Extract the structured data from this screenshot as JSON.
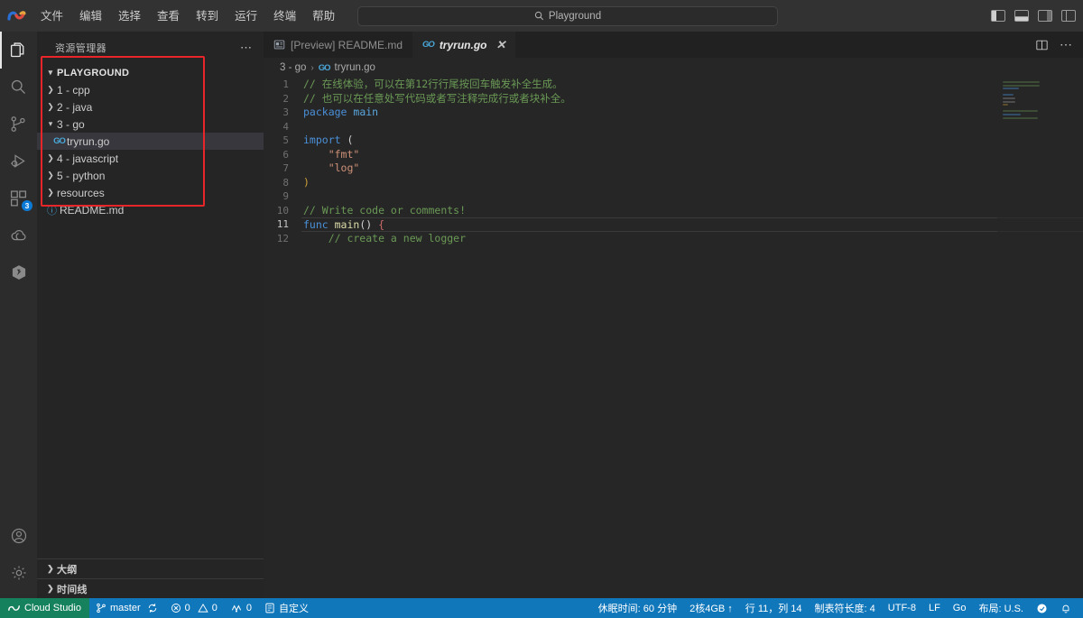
{
  "titlebar": {
    "logo_name": "cloud-studio-logo",
    "menu": [
      {
        "label": "文件",
        "name": "menu-file"
      },
      {
        "label": "编辑",
        "name": "menu-edit"
      },
      {
        "label": "选择",
        "name": "menu-selection"
      },
      {
        "label": "查看",
        "name": "menu-view"
      },
      {
        "label": "转到",
        "name": "menu-go"
      },
      {
        "label": "运行",
        "name": "menu-run"
      },
      {
        "label": "终端",
        "name": "menu-terminal"
      },
      {
        "label": "帮助",
        "name": "menu-help"
      }
    ],
    "nav": {
      "back": "←",
      "forward": "→"
    },
    "search": {
      "value": "Playground",
      "icon": "search-icon"
    },
    "window_controls": [
      {
        "name": "toggle-primary-sidebar-button"
      },
      {
        "name": "toggle-panel-button"
      },
      {
        "name": "toggle-secondary-sidebar-button"
      },
      {
        "name": "customize-layout-button"
      }
    ]
  },
  "activitybar": {
    "items": [
      {
        "name": "activity-explorer",
        "icon": "files-icon",
        "active": true
      },
      {
        "name": "activity-search",
        "icon": "search-icon",
        "active": false
      },
      {
        "name": "activity-source-control",
        "icon": "source-control-icon",
        "active": false
      },
      {
        "name": "activity-run-debug",
        "icon": "run-debug-icon",
        "active": false
      },
      {
        "name": "activity-extensions",
        "icon": "extensions-icon",
        "active": false,
        "badge": "3"
      },
      {
        "name": "activity-cloud",
        "icon": "cloud-icon",
        "active": false
      },
      {
        "name": "activity-plugin",
        "icon": "hexagon-icon",
        "active": false
      }
    ],
    "bottom": [
      {
        "name": "activity-account",
        "icon": "account-icon"
      },
      {
        "name": "activity-settings",
        "icon": "gear-icon"
      }
    ]
  },
  "sidebar": {
    "title": "资源管理器",
    "more_actions": "⋯",
    "tree": [
      {
        "label": "PLAYGROUND",
        "name": "tree-root-playground",
        "kind": "root",
        "expanded": true,
        "indent": 0
      },
      {
        "label": "1 - cpp",
        "name": "tree-folder-cpp",
        "kind": "folder",
        "expanded": false,
        "indent": 1
      },
      {
        "label": "2 - java",
        "name": "tree-folder-java",
        "kind": "folder",
        "expanded": false,
        "indent": 1
      },
      {
        "label": "3 - go",
        "name": "tree-folder-go",
        "kind": "folder",
        "expanded": true,
        "indent": 1
      },
      {
        "label": "tryrun.go",
        "name": "tree-file-tryrun-go",
        "kind": "file-go",
        "selected": true,
        "indent": 2
      },
      {
        "label": "4 - javascript",
        "name": "tree-folder-javascript",
        "kind": "folder",
        "expanded": false,
        "indent": 1
      },
      {
        "label": "5 - python",
        "name": "tree-folder-python",
        "kind": "folder",
        "expanded": false,
        "indent": 1
      },
      {
        "label": "resources",
        "name": "tree-folder-resources",
        "kind": "folder",
        "expanded": false,
        "indent": 1
      },
      {
        "label": "README.md",
        "name": "tree-file-readme-md",
        "kind": "file-md",
        "indent": 1
      }
    ],
    "sections": [
      {
        "label": "大纲",
        "name": "sidebar-section-outline"
      },
      {
        "label": "时间线",
        "name": "sidebar-section-timeline"
      }
    ],
    "annotation_color": "#e8262a"
  },
  "editor": {
    "tabs": [
      {
        "label": "[Preview] README.md",
        "name": "tab-readme-preview",
        "icon": "preview-icon",
        "active": false
      },
      {
        "label": "tryrun.go",
        "name": "tab-tryrun-go",
        "icon": "go-icon",
        "active": true,
        "close": "✕"
      }
    ],
    "tab_actions": [
      {
        "name": "split-editor-button"
      },
      {
        "name": "editor-more-actions-button",
        "label": "⋯"
      }
    ],
    "breadcrumb": {
      "folder": "3 - go",
      "separator": "›",
      "file": "tryrun.go"
    },
    "lines": [
      {
        "n": "1",
        "tokens": [
          {
            "t": "// 在线体验，可以在第12行行尾按回车触发补全生成。",
            "c": "cmt"
          }
        ]
      },
      {
        "n": "2",
        "tokens": [
          {
            "t": "// 也可以在任意处写代码或者写注释完成行或者块补全。",
            "c": "cmt"
          }
        ]
      },
      {
        "n": "3",
        "tokens": [
          {
            "t": "package ",
            "c": "kw"
          },
          {
            "t": "main",
            "c": "kw2"
          }
        ]
      },
      {
        "n": "4",
        "tokens": []
      },
      {
        "n": "5",
        "tokens": [
          {
            "t": "import ",
            "c": "kw"
          },
          {
            "t": "(",
            "c": "punc"
          }
        ]
      },
      {
        "n": "6",
        "tokens": [
          {
            "t": "    ",
            "c": "punc"
          },
          {
            "t": "\"fmt\"",
            "c": "str"
          }
        ]
      },
      {
        "n": "7",
        "tokens": [
          {
            "t": "    ",
            "c": "punc"
          },
          {
            "t": "\"log\"",
            "c": "str"
          }
        ]
      },
      {
        "n": "8",
        "tokens": [
          {
            "t": ")",
            "c": "brk"
          }
        ]
      },
      {
        "n": "9",
        "tokens": []
      },
      {
        "n": "10",
        "tokens": [
          {
            "t": "// Write code or comments!",
            "c": "cmt"
          }
        ]
      },
      {
        "n": "11",
        "tokens": [
          {
            "t": "func ",
            "c": "kw"
          },
          {
            "t": "main",
            "c": "fn"
          },
          {
            "t": "()",
            "c": "punc"
          },
          {
            "t": " {",
            "c": "brk2"
          }
        ],
        "active": true
      },
      {
        "n": "12",
        "tokens": [
          {
            "t": "    // create a new logger",
            "c": "cmt"
          }
        ]
      }
    ],
    "minimap_name": "editor-minimap"
  },
  "statusbar": {
    "left": [
      {
        "label": "Cloud Studio",
        "name": "status-cloud-studio",
        "icon": "cloud-studio-icon"
      },
      {
        "label": "master",
        "name": "status-branch",
        "icon": "branch-icon",
        "icon2": "sync-icon"
      },
      {
        "label": "0",
        "name": "status-errors",
        "icon": "error-icon",
        "label2": "0",
        "icon2": "warning-icon"
      },
      {
        "label": "0",
        "name": "status-ports",
        "icon": "ports-icon"
      },
      {
        "label": "自定义",
        "name": "status-customize",
        "icon": "customize-icon"
      }
    ],
    "right": [
      {
        "label": "休眠时间: 60 分钟",
        "name": "status-hibernate-time"
      },
      {
        "label": "2核4GB ↑",
        "name": "status-spec"
      },
      {
        "label": "行 11，列 14",
        "name": "status-cursor-position"
      },
      {
        "label": "制表符长度: 4",
        "name": "status-indent"
      },
      {
        "label": "UTF-8",
        "name": "status-encoding"
      },
      {
        "label": "LF",
        "name": "status-eol"
      },
      {
        "label": "Go",
        "name": "status-language-mode"
      },
      {
        "label": "布局: U.S.",
        "name": "status-keyboard-layout"
      },
      {
        "label": "",
        "name": "status-feedback-icon"
      },
      {
        "label": "",
        "name": "status-notifications-icon"
      }
    ]
  }
}
